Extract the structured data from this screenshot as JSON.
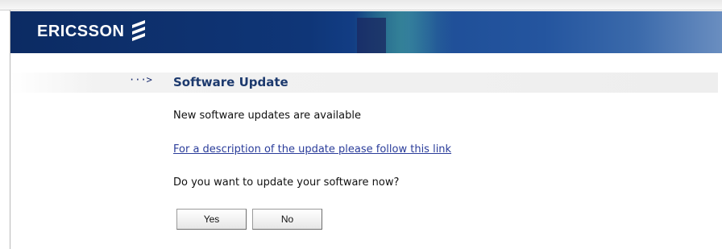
{
  "header": {
    "brand": "ERICSSON",
    "logo_icon": "ericsson-logo-icon"
  },
  "section": {
    "arrow": "···>",
    "title": "Software Update"
  },
  "content": {
    "message": "New software updates are available",
    "link_text": "For a description of the update please follow this link",
    "question": "Do you want to update your software now?"
  },
  "buttons": {
    "yes_label": "Yes",
    "no_label": "No"
  },
  "colors": {
    "banner": "#0f3678",
    "title": "#1d3a6e",
    "link": "#2a3c9a"
  }
}
